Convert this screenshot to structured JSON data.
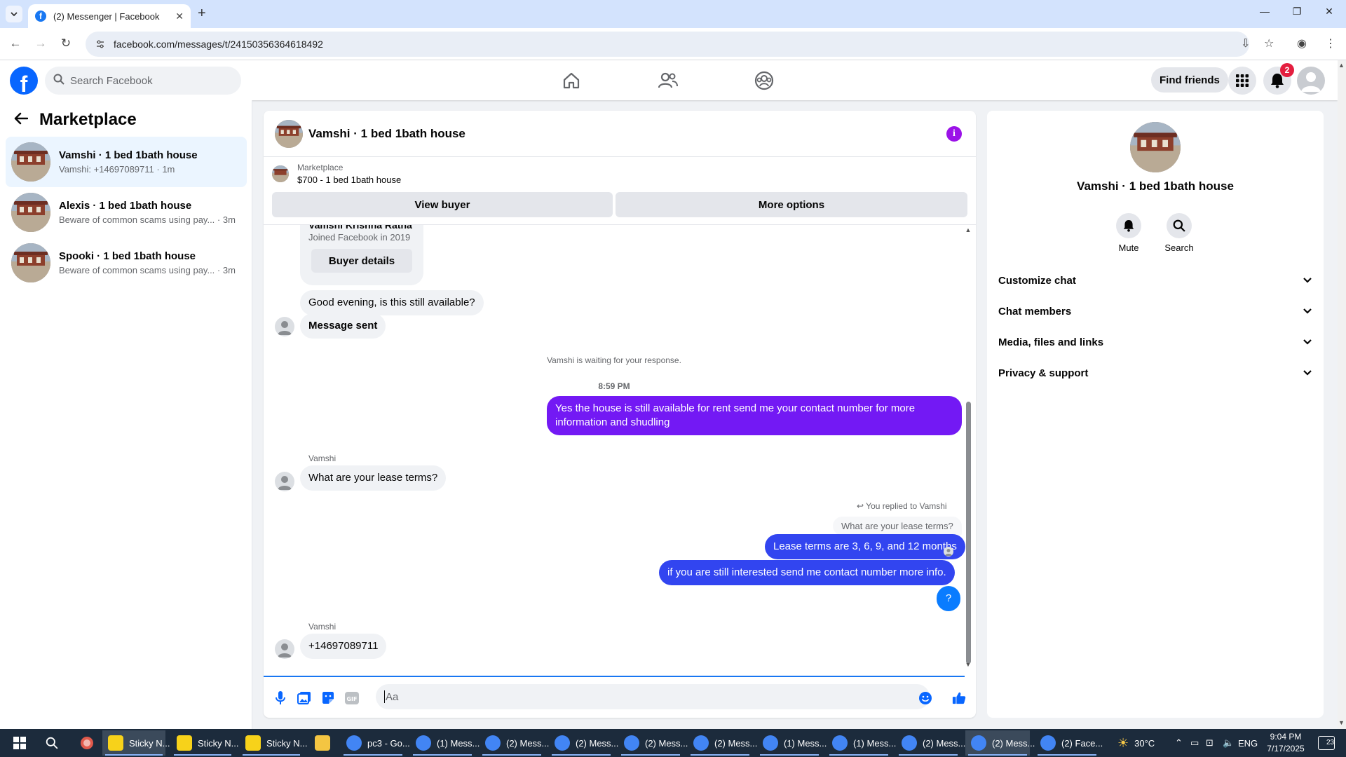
{
  "browser": {
    "tab_title": "(2) Messenger | Facebook",
    "url": "facebook.com/messages/t/24150356364618492"
  },
  "fb_header": {
    "search_placeholder": "Search Facebook",
    "find_friends": "Find friends",
    "notification_count": "2"
  },
  "left_panel": {
    "title": "Marketplace",
    "conversations": [
      {
        "title": "Vamshi · 1 bed 1bath house",
        "subtitle": "Vamshi: +14697089711 · 1m",
        "active": true
      },
      {
        "title": "Alexis · 1 bed 1bath house",
        "subtitle": "Beware of common scams using pay... · 3m",
        "active": false
      },
      {
        "title": "Spooki · 1 bed 1bath house",
        "subtitle": "Beware of common scams using pay... · 3m",
        "active": false
      }
    ]
  },
  "chat": {
    "title": "Vamshi · 1 bed 1bath house",
    "marketplace_label": "Marketplace",
    "listing": "$700 - 1 bed 1bath house",
    "view_buyer": "View buyer",
    "more_options": "More options",
    "buyer_card": {
      "name": "Vamshi Krishna Ratha",
      "joined": "Joined Facebook in 2019",
      "details_button": "Buyer details"
    },
    "messages": {
      "m1": "Good evening, is this still available?",
      "m2": "Message sent",
      "waiting": "Vamshi is waiting for your response.",
      "time": "8:59 PM",
      "m3": "Yes the house is still available for rent send me your contact number for more information and shudling",
      "sender1": "Vamshi",
      "m4": "What are your lease terms?",
      "replied_to": "You replied to Vamshi",
      "quoted": "What are your lease terms?",
      "m5": "Lease terms are 3, 6, 9, and 12 months",
      "m6": "if you  are still interested send me contact number more info.",
      "m7": "?",
      "sender2": "Vamshi",
      "m8": "+14697089711"
    },
    "composer_placeholder": "Aa"
  },
  "right_panel": {
    "name": "Vamshi · 1 bed 1bath house",
    "mute": "Mute",
    "search": "Search",
    "sections": [
      "Customize chat",
      "Chat members",
      "Media, files and links",
      "Privacy & support"
    ]
  },
  "taskbar": {
    "items": [
      "Sticky N...",
      "Sticky N...",
      "Sticky N...",
      "pc3 - Go...",
      "(1) Mess...",
      "(2) Mess...",
      "(2) Mess...",
      "(2) Mess...",
      "(2) Mess...",
      "(1) Mess...",
      "(1) Mess...",
      "(2) Mess...",
      "(2) Mess...",
      "(2) Face..."
    ],
    "weather": "30°C",
    "language": "ENG",
    "time": "9:04 PM",
    "date": "7/17/2025",
    "notif_count": "23"
  },
  "colors": {
    "fb_blue": "#0866ff",
    "outgoing_purple": "#7319f4",
    "outgoing_blue": "#3245f0",
    "active_conv_bg": "#ebf5ff",
    "info_purple": "#9b12e8"
  }
}
